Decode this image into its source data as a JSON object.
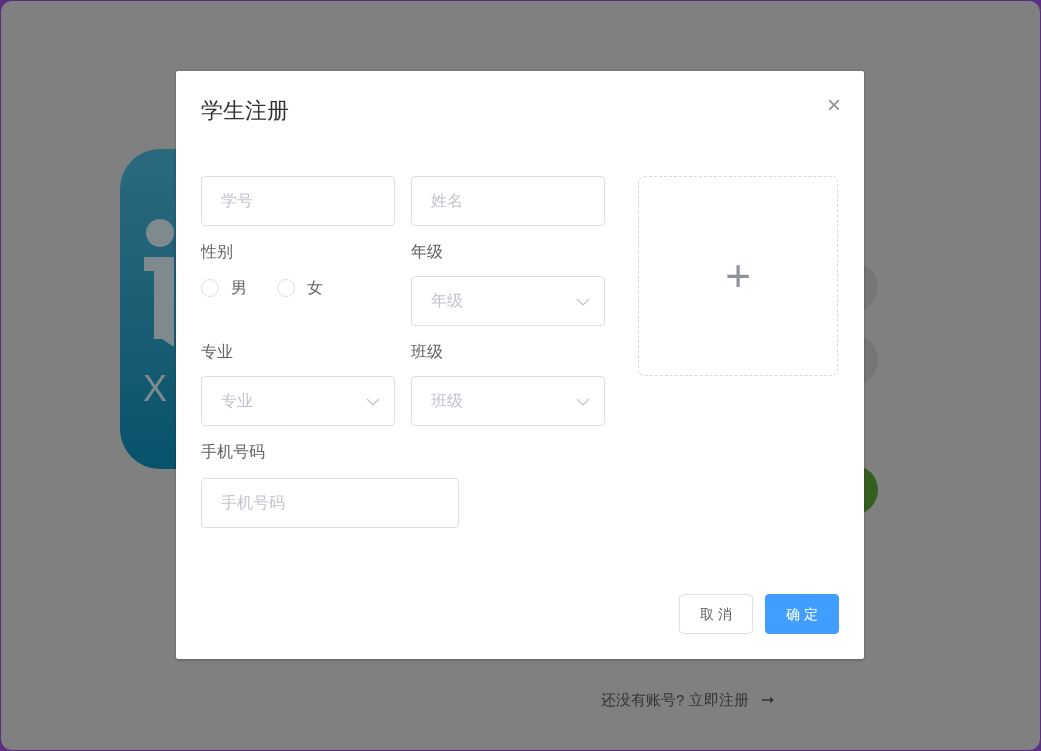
{
  "background": {
    "logo": {
      "text": "X"
    },
    "register_link": {
      "text": "还没有账号? 立即注册",
      "arrow": "➞"
    }
  },
  "dialog": {
    "title": "学生注册",
    "close": "×",
    "fields": [
      {
        "kind": "input",
        "placeholder": "学号"
      },
      {
        "kind": "input",
        "placeholder": "姓名"
      },
      {
        "kind": "radio",
        "label": "性别",
        "options": [
          {
            "label": "男",
            "selected": false
          },
          {
            "label": "女",
            "selected": false
          }
        ]
      },
      {
        "kind": "select",
        "label": "年级",
        "placeholder": "年级"
      },
      {
        "kind": "select",
        "label": "专业",
        "placeholder": "专业"
      },
      {
        "kind": "select",
        "label": "班级",
        "placeholder": "班级"
      },
      {
        "kind": "wide-input",
        "label": "手机号码",
        "placeholder": "手机号码"
      }
    ],
    "upload": {
      "icon": "+"
    },
    "buttons": [
      {
        "kind": "default",
        "label": "取 消"
      },
      {
        "kind": "primary",
        "label": "确 定"
      }
    ]
  }
}
